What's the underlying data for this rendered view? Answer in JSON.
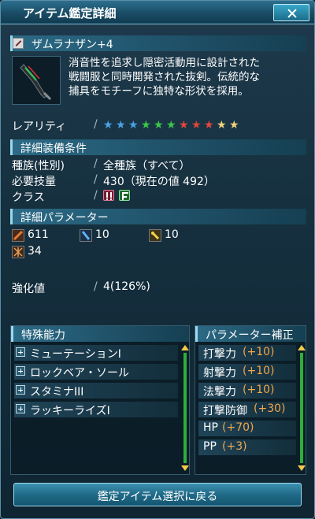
{
  "window": {
    "title": "アイテム鑑定詳細",
    "close_label": ""
  },
  "item": {
    "name": "ザムラナザン+4",
    "description_lines": [
      "消音性を追求し隠密活動用に設計された",
      "戦闘服と同時開発された抜剣。伝統的な",
      "捕具をモチーフに独特な形状を採用。"
    ]
  },
  "rarity": {
    "label": "レアリティ",
    "stars": [
      {
        "color": "#4aa3e6"
      },
      {
        "color": "#4aa3e6"
      },
      {
        "color": "#4aa3e6"
      },
      {
        "color": "#3ec64b"
      },
      {
        "color": "#3ec64b"
      },
      {
        "color": "#3ec64b"
      },
      {
        "color": "#e5453a"
      },
      {
        "color": "#e5453a"
      },
      {
        "color": "#e5453a"
      },
      {
        "color": "#f2d37a"
      },
      {
        "color": "#f2d37a"
      }
    ]
  },
  "requirements": {
    "section_title": "詳細装備条件",
    "rows": [
      {
        "label": "種族(性別)",
        "value": "全種族（すべて）"
      },
      {
        "label": "必要技量",
        "value": "430（現在の値 492）"
      },
      {
        "label": "クラス",
        "value": ""
      }
    ],
    "class_icons": [
      "hunter-class-icon",
      "fighter-class-icon"
    ]
  },
  "parameters": {
    "section_title": "詳細パラメーター",
    "stats": [
      {
        "icon": "strike-attack-icon",
        "value": "611"
      },
      {
        "icon": "ranged-attack-icon",
        "value": "10"
      },
      {
        "icon": "tech-attack-icon",
        "value": "10"
      },
      {
        "icon": "dexterity-icon",
        "value": "34"
      }
    ],
    "grind_label": "強化値",
    "grind_value": "4(126%)"
  },
  "special_abilities": {
    "title": "特殊能力",
    "items": [
      "ミューテーションI",
      "ロックベア・ソール",
      "スタミナIII",
      "ラッキーライズI"
    ]
  },
  "param_bonus": {
    "title": "パラメーター補正",
    "items": [
      {
        "name": "打撃力",
        "value": "(+10)"
      },
      {
        "name": "射撃力",
        "value": "(+10)"
      },
      {
        "name": "法撃力",
        "value": "(+10)"
      },
      {
        "name": "打撃防御",
        "value": "(+30)"
      },
      {
        "name": "HP",
        "value": "(+70)"
      },
      {
        "name": "PP",
        "value": "(+3)"
      }
    ]
  },
  "footer": {
    "back_label": "鑑定アイテム選択に戻る"
  },
  "colors": {
    "accent": "#9ad8ef",
    "bonus": "#f3a64a",
    "scroll": "#2fae3c"
  }
}
